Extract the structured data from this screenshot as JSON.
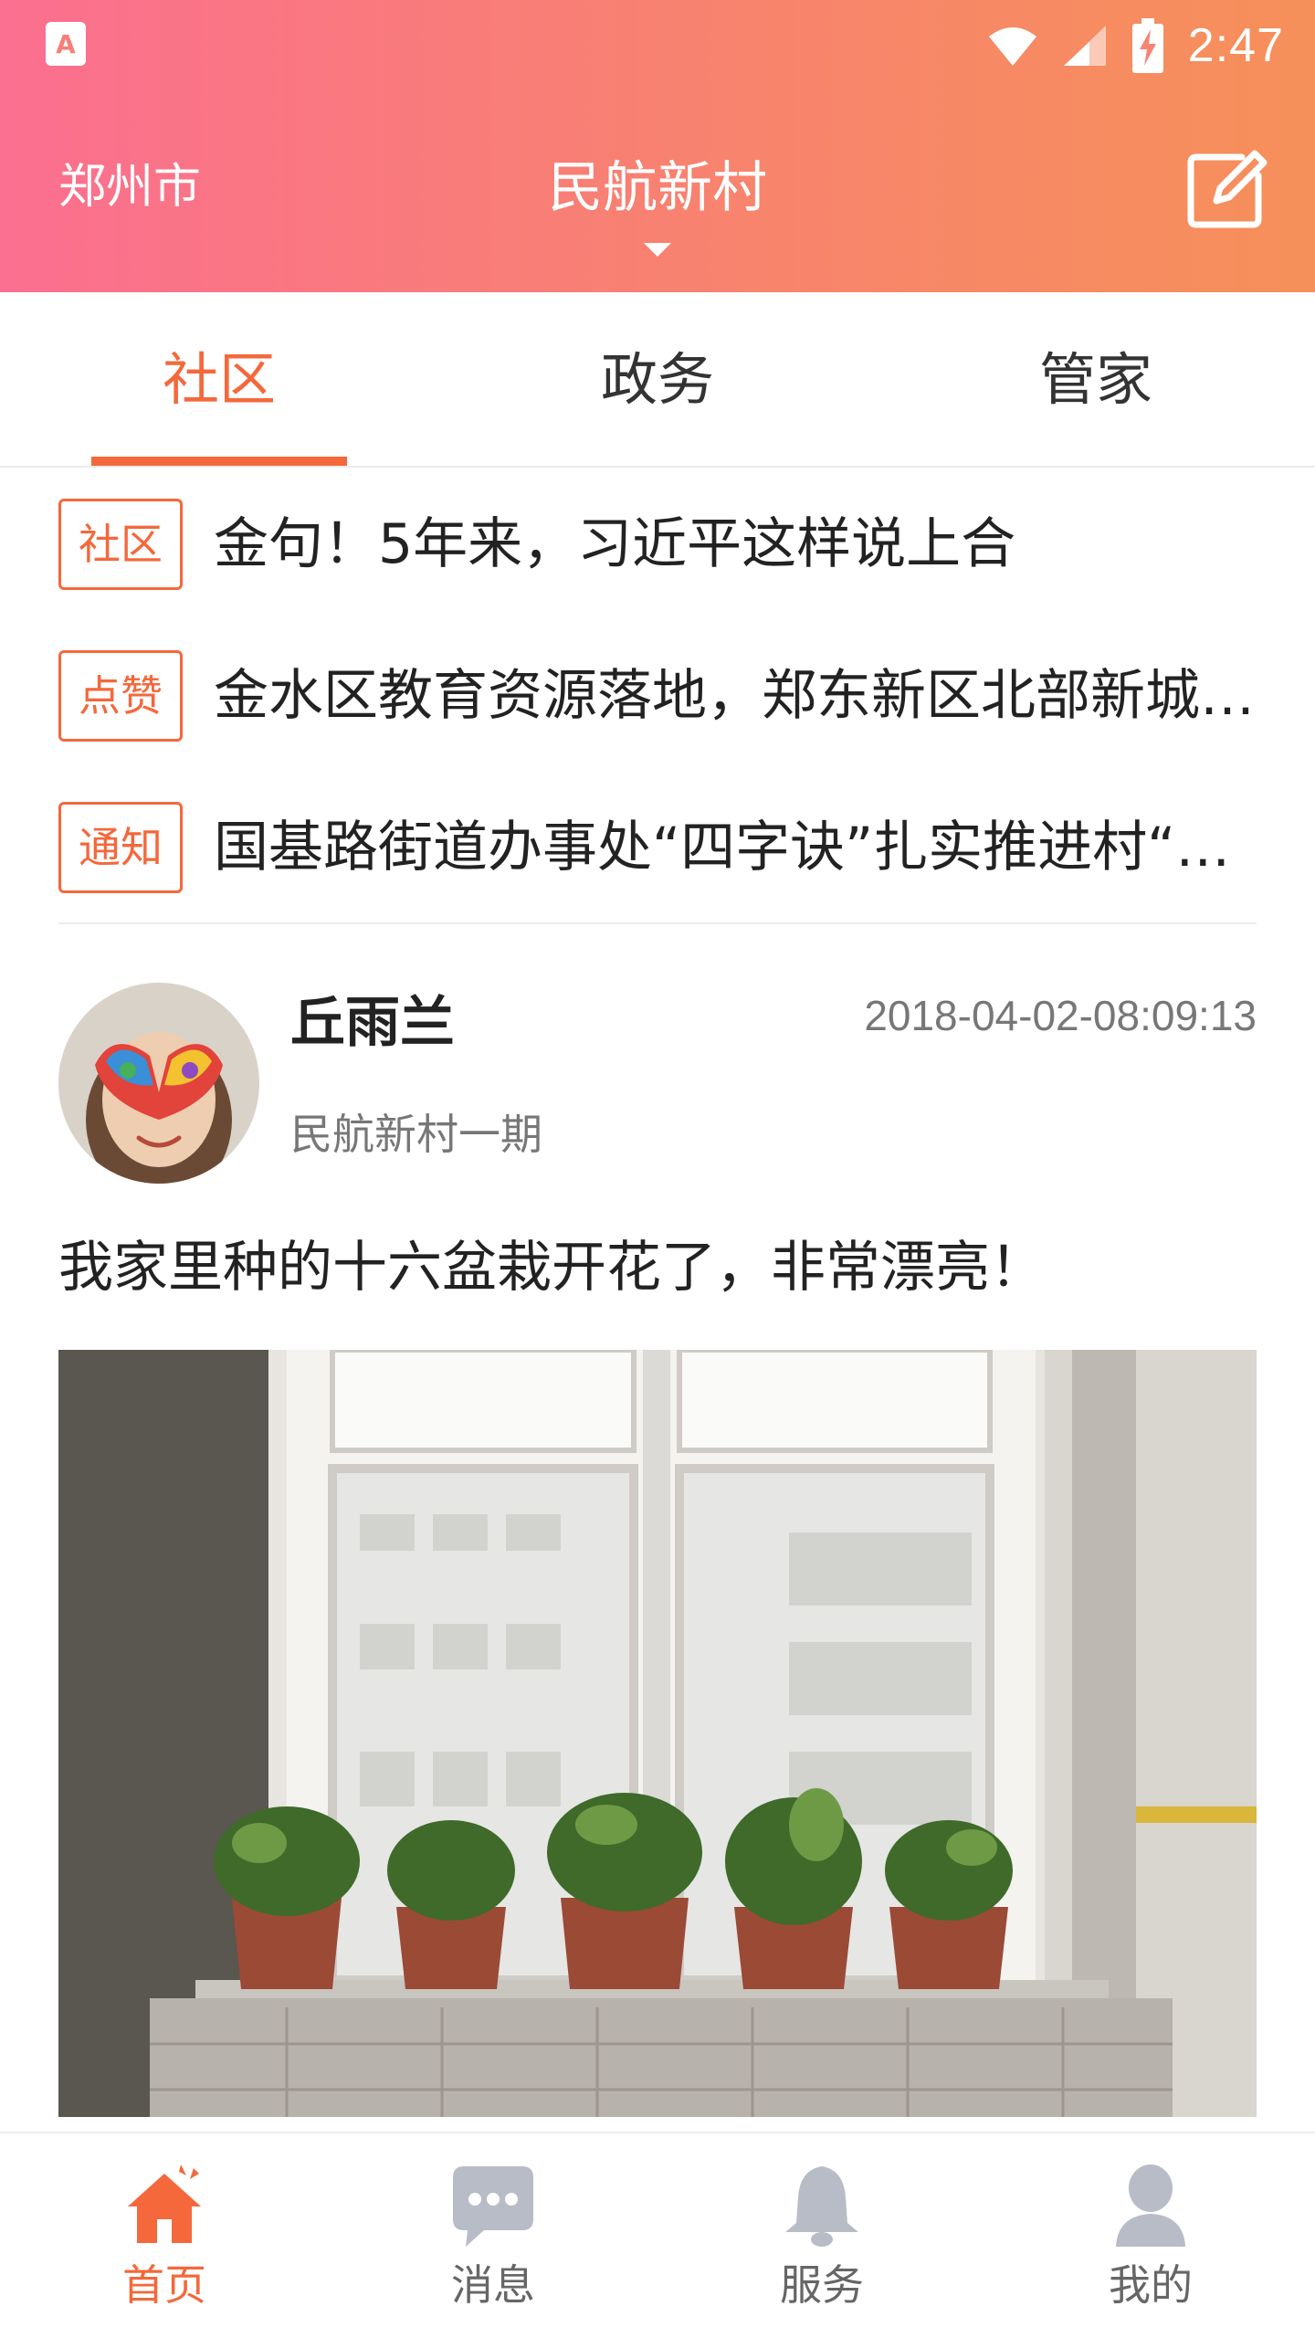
{
  "status_bar": {
    "time": "2:47",
    "app_icon_letter": "A",
    "icons": [
      "wifi-icon",
      "signal-icon",
      "battery-charging-icon"
    ]
  },
  "appbar": {
    "city": "郑州市",
    "community": "民航新村",
    "edit_icon": "edit-icon"
  },
  "tabs": [
    {
      "label": "社区",
      "active": true
    },
    {
      "label": "政务",
      "active": false
    },
    {
      "label": "管家",
      "active": false
    }
  ],
  "news": [
    {
      "tag": "社区",
      "title": "金句！5年来，习近平这样说上合"
    },
    {
      "tag": "点赞",
      "title": "金水区教育资源落地，郑东新区北部新城教育资源"
    },
    {
      "tag": "通知",
      "title": "国基路街道办事处“四字诀”扎实推进村“两委”换届"
    }
  ],
  "post": {
    "author": "丘雨兰",
    "location": "民航新村一期",
    "time": "2018-04-02-08:09:13",
    "text": "我家里种的十六盆栽开花了，非常漂亮！"
  },
  "bottom_nav": [
    {
      "label": "首页",
      "icon": "home-icon",
      "active": true
    },
    {
      "label": "消息",
      "icon": "message-icon",
      "active": false
    },
    {
      "label": "服务",
      "icon": "bell-icon",
      "active": false
    },
    {
      "label": "我的",
      "icon": "user-icon",
      "active": false
    }
  ],
  "colors": {
    "accent": "#f4683b",
    "gradient_start": "#fb6f90",
    "gradient_end": "#f6905a",
    "nav_inactive": "#b8bcc6"
  }
}
